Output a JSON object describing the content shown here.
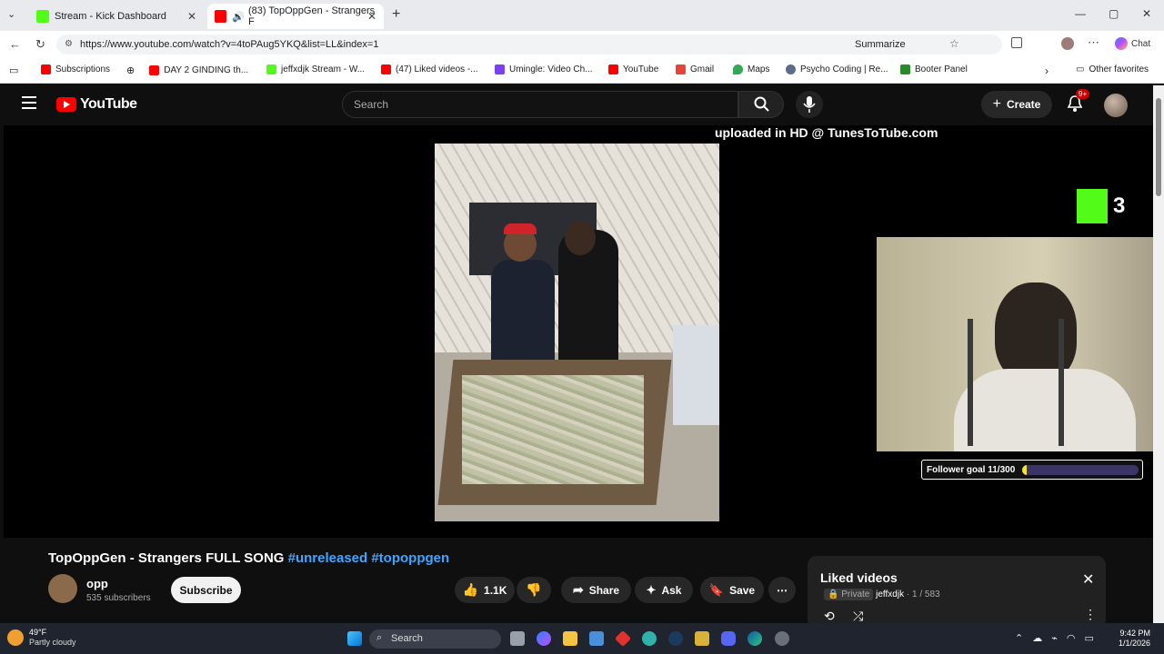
{
  "browser": {
    "tabs": [
      {
        "title": "Stream - Kick Dashboard",
        "favicon_color": "#53fc18"
      },
      {
        "title": "(83) TopOppGen - Strangers F",
        "favicon_color": "#ff0000",
        "active": true
      }
    ],
    "url": "https://www.youtube.com/watch?v=4toPAug5YKQ&list=LL&index=1",
    "summarize_label": "Summarize",
    "chat_label": "Chat",
    "bookmarks": [
      {
        "label": "Subscriptions",
        "color": "#ff0000"
      },
      {
        "label": "DAY 2 GINDING th...",
        "color": "#ff0000"
      },
      {
        "label": "jeffxdjk Stream - W...",
        "color": "#53fc18"
      },
      {
        "label": "(47) Liked videos -...",
        "color": "#ff0000"
      },
      {
        "label": "Umingle: Video Ch...",
        "color": "#7b3ff2"
      },
      {
        "label": "YouTube",
        "color": "#ff0000"
      },
      {
        "label": "Gmail",
        "color": "#ea4335"
      },
      {
        "label": "Maps",
        "color": "#34a853"
      },
      {
        "label": "Psycho Coding | Re...",
        "color": "#5b6b8a"
      },
      {
        "label": "Booter Panel",
        "color": "#2a8a2a"
      }
    ],
    "other_favorites": "Other favorites"
  },
  "youtube": {
    "logo_text": "YouTube",
    "search_placeholder": "Search",
    "create_label": "Create",
    "notification_badge": "9+",
    "overlay_text": "uploaded in HD @ TunesToTube.com",
    "kick_count": "3",
    "follower_goal": "Follower goal 11/300",
    "follower_goal_progress": 0.037,
    "video_title": "TopOppGen - Strangers FULL SONG ",
    "hashtag1": "#unreleased",
    "hashtag2": "#topoppgen",
    "channel_name": "opp",
    "subscribers": "535 subscribers",
    "subscribe_label": "Subscribe",
    "likes": "1.1K",
    "share_label": "Share",
    "ask_label": "Ask",
    "save_label": "Save",
    "playlist": {
      "title": "Liked videos",
      "privacy": "Private",
      "owner": "jeffxdjk",
      "position": "1 / 583"
    }
  },
  "taskbar": {
    "temperature": "49°F",
    "weather": "Partly cloudy",
    "search_label": "Search",
    "time": "9:42 PM",
    "date": "1/1/2026"
  }
}
